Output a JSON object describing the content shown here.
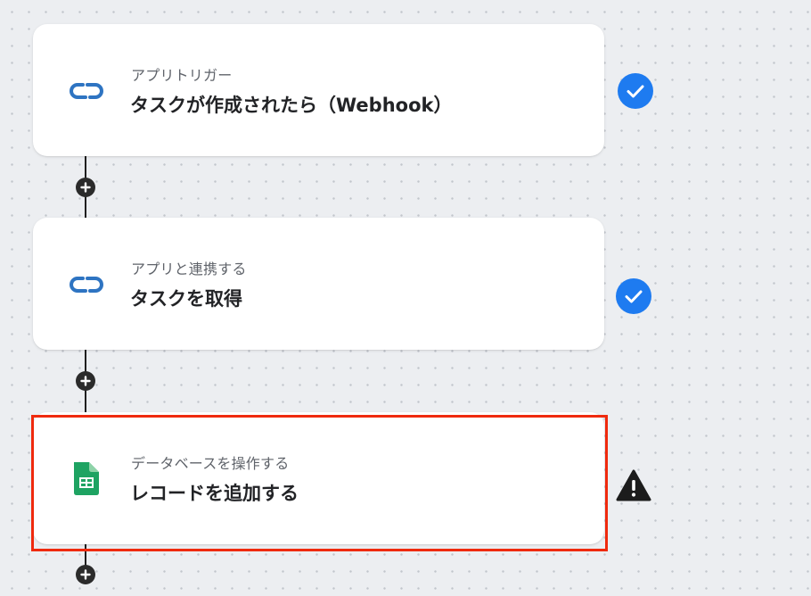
{
  "flow": {
    "steps": [
      {
        "kicker": "アプリトリガー",
        "title": "タスクが作成されたら（Webhook）",
        "icon": "zoho-link-icon",
        "status": "complete"
      },
      {
        "kicker": "アプリと連携する",
        "title": "タスクを取得",
        "icon": "zoho-link-icon",
        "status": "complete"
      },
      {
        "kicker": "データベースを操作する",
        "title": "レコードを追加する",
        "icon": "google-sheets-icon",
        "status": "warning"
      }
    ]
  },
  "colors": {
    "check_blue": "#1e7bf0",
    "link_icon_blue": "#2e74c2",
    "sheets_green": "#1ea362",
    "highlight_red": "#ef2a0e",
    "warning_black": "#1c1c1c",
    "connector": "#1f1f1f"
  }
}
